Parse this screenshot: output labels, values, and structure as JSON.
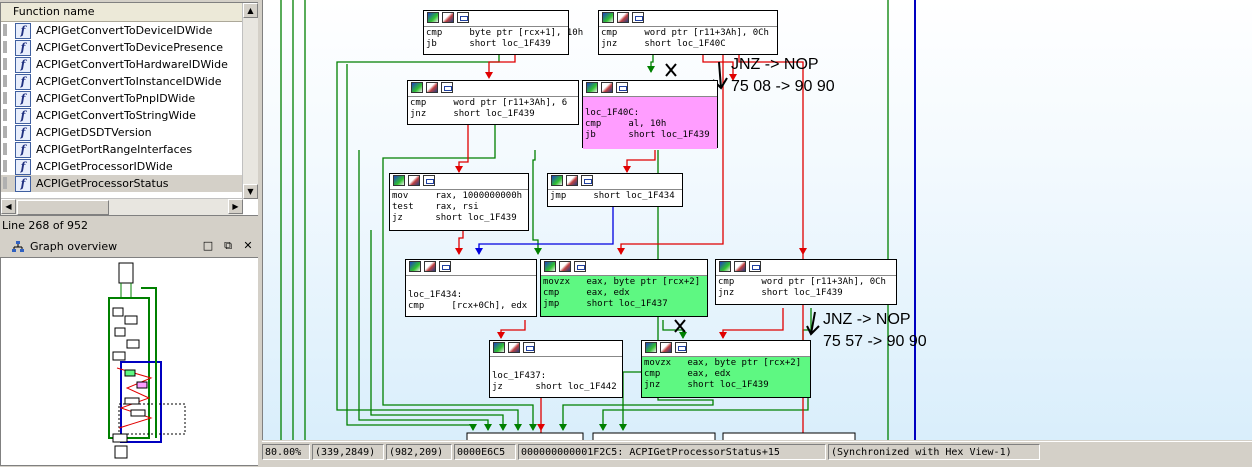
{
  "functions_panel": {
    "header": "Function name",
    "items": [
      "ACPIGetConvertToDeviceIDWide",
      "ACPIGetConvertToDevicePresence",
      "ACPIGetConvertToHardwareIDWide",
      "ACPIGetConvertToInstanceIDWide",
      "ACPIGetConvertToPnpIDWide",
      "ACPIGetConvertToStringWide",
      "ACPIGetDSDTVersion",
      "ACPIGetPortRangeInterfaces",
      "ACPIGetProcessorIDWide",
      "ACPIGetProcessorStatus"
    ],
    "selected_index": 9,
    "line_info": "Line 268 of 952"
  },
  "graph_overview": {
    "title": "Graph overview",
    "buttons": [
      "□",
      "⧉",
      "✕"
    ]
  },
  "graph": {
    "nodes": [
      {
        "id": "n1",
        "lines": [
          "cmp     byte ptr [rcx+1], 10h",
          "jb      short loc_1F439"
        ]
      },
      {
        "id": "n2",
        "lines": [
          "cmp     word ptr [r11+3Ah], 0Ch",
          "jnz     short loc_1F40C"
        ]
      },
      {
        "id": "n3",
        "lines": [
          "cmp     word ptr [r11+3Ah], 6",
          "jnz     short loc_1F439"
        ]
      },
      {
        "id": "n4",
        "lines": [
          "loc_1F40C:",
          "cmp     al, 10h",
          "jb      short loc_1F439"
        ]
      },
      {
        "id": "n5",
        "lines": [
          "mov     rax, 1000000000h",
          "test    rax, rsi",
          "jz      short loc_1F439"
        ]
      },
      {
        "id": "n6",
        "lines": [
          "jmp     short loc_1F434"
        ]
      },
      {
        "id": "n7",
        "lines": [
          "loc_1F434:",
          "cmp     [rcx+0Ch], edx"
        ]
      },
      {
        "id": "n8",
        "lines": [
          "movzx   eax, byte ptr [rcx+2]",
          "cmp     eax, edx",
          "jmp     short loc_1F437"
        ]
      },
      {
        "id": "n9",
        "lines": [
          "cmp     word ptr [r11+3Ah], 0Ch",
          "jnz     short loc_1F439"
        ]
      },
      {
        "id": "n10",
        "lines": [
          "loc_1F437:",
          "jz      short loc_1F442"
        ]
      },
      {
        "id": "n11",
        "lines": [
          "movzx   eax, byte ptr [rcx+2]",
          "cmp     eax, edx",
          "jnz     short loc_1F439"
        ]
      }
    ]
  },
  "annotations": {
    "a1_line1": "JNZ -> NOP",
    "a1_line2": "75 08 -> 90 90",
    "a2_line1": "JNZ -> NOP",
    "a2_line2": "75 57 -> 90 90"
  },
  "status_bar": {
    "zoom": "80.00%",
    "coords1": "(339,2849)",
    "coords2": "(982,209)",
    "offset": "0000E6C5",
    "address": "000000000001F2C5: ACPIGetProcessorStatus+15",
    "sync": "(Synchronized with Hex View-1)"
  }
}
